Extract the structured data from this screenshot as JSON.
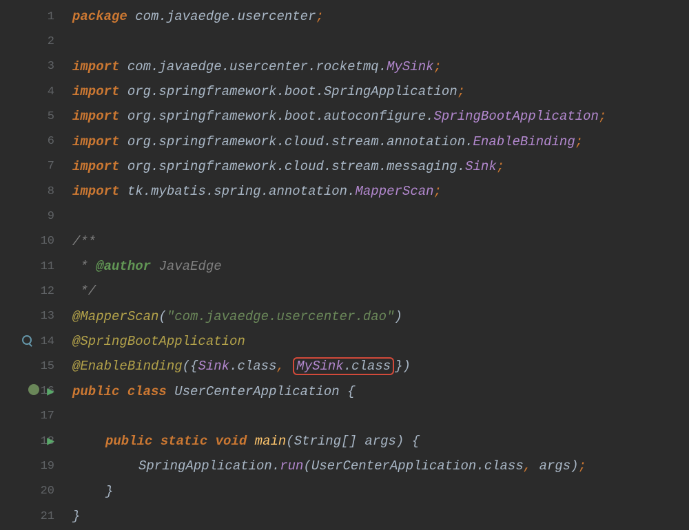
{
  "gutter": {
    "lines": [
      "1",
      "2",
      "3",
      "4",
      "5",
      "6",
      "7",
      "8",
      "9",
      "10",
      "11",
      "12",
      "13",
      "14",
      "15",
      "16",
      "17",
      "18",
      "19",
      "20",
      "21"
    ]
  },
  "code": {
    "package_kw": "package",
    "package_path": "com.javaedge.usercenter",
    "import_kw": "import",
    "imports": [
      {
        "path": "com.javaedge.usercenter.rocketmq",
        "cls": "MySink"
      },
      {
        "path": "org.springframework.boot",
        "cls": "SpringApplication"
      },
      {
        "path": "org.springframework.boot.autoconfigure",
        "cls": "SpringBootApplication"
      },
      {
        "path": "org.springframework.cloud.stream.annotation",
        "cls": "EnableBinding"
      },
      {
        "path": "org.springframework.cloud.stream.messaging",
        "cls": "Sink"
      },
      {
        "path": "tk.mybatis.spring.annotation",
        "cls": "MapperScan"
      }
    ],
    "javadoc_open": "/**",
    "javadoc_author_tag": "@author",
    "javadoc_author_name": "JavaEdge",
    "javadoc_star": " *",
    "javadoc_close": " */",
    "ann_mapperscan": "@MapperScan",
    "ann_mapperscan_arg": "\"com.javaedge.usercenter.dao\"",
    "ann_springboot": "@SpringBootApplication",
    "ann_enablebinding": "@EnableBinding",
    "enable_sink": "Sink",
    "enable_mysink": "MySink",
    "class_kw": "class",
    "public_kw": "public",
    "static_kw": "static",
    "void_kw": "void",
    "class_name": "UserCenterApplication",
    "main_name": "main",
    "main_param_type": "String[]",
    "main_param_name": "args",
    "run_target": "SpringApplication",
    "run_method": "run",
    "run_arg1": "UserCenterApplication",
    "run_arg2": "args",
    "class_suffix": ".class",
    "brace_open": "{",
    "brace_close": "}",
    "paren_open": "(",
    "paren_close": ")",
    "semicolon": ";",
    "comma": ", ",
    "dot": "."
  }
}
